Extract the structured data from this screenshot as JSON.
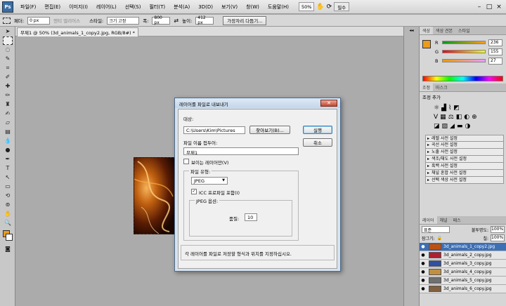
{
  "app": {
    "logo": "Ps",
    "menus": [
      "파일(F)",
      "편집(E)",
      "이미지(I)",
      "레이어(L)",
      "선택(S)",
      "필터(T)",
      "분석(A)",
      "3D(D)",
      "보기(V)",
      "창(W)",
      "도움말(H)"
    ],
    "zoom": "50%",
    "workspace": "필수",
    "colors": {
      "accent": "#3d6fb4",
      "foreground": "#ec9b1b"
    }
  },
  "options": {
    "feather_label": "페더:",
    "feather_value": "0 px",
    "antialias_label": "앤티 앨리어스",
    "style_label": "스타일:",
    "style_value": "크기 고정",
    "width_label": "폭:",
    "width_value": "800 px",
    "height_label": "높이:",
    "height_value": "412 px",
    "refine_button": "가장자리 다듬기..."
  },
  "document": {
    "tab_title": "무제1 @ 50% (3d_animals_1_copy2.jpg, RGB/8#) *"
  },
  "color_panel": {
    "tabs": [
      "색상",
      "색상 견본",
      "스타일"
    ],
    "channels": [
      {
        "label": "R",
        "value": "236"
      },
      {
        "label": "G",
        "value": "155"
      },
      {
        "label": "B",
        "value": "27"
      }
    ]
  },
  "adjust_panel": {
    "tabs": [
      "조정",
      "마스크"
    ],
    "title": "조정 추가",
    "presets": [
      "레벨 사전 설정",
      "곡선 사전 설정",
      "노출 사전 설정",
      "색조/채도 사전 설정",
      "흑백 사전 설정",
      "채널 혼합 사전 설정",
      "선택 색상 사전 설정"
    ]
  },
  "layers_panel": {
    "tabs": [
      "레이어",
      "채널",
      "패스"
    ],
    "blend_mode": "표준",
    "opacity_label": "불투명도:",
    "opacity_value": "100%",
    "lock_label": "잠그기:",
    "fill_label": "칠:",
    "fill_value": "100%",
    "layers": [
      {
        "name": "3d_animals_1_copy2.jpg",
        "selected": true,
        "color": "#c05010"
      },
      {
        "name": "3d_animals_2_copy.jpg",
        "selected": false,
        "color": "#b02030"
      },
      {
        "name": "3d_animals_3_copy.jpg",
        "selected": false,
        "color": "#3050a0"
      },
      {
        "name": "3d_animals_4_copy.jpg",
        "selected": false,
        "color": "#c09040"
      },
      {
        "name": "3d_animals_5_copy.jpg",
        "selected": false,
        "color": "#707070"
      },
      {
        "name": "3d_animals_6_copy.jpg",
        "selected": false,
        "color": "#806040"
      }
    ]
  },
  "dialog": {
    "title": "레이어를 파일로 내보내기",
    "target_label": "대상:",
    "target_path": "C:\\Users\\Kim\\Pictures",
    "browse_button": "찾아보기(B)...",
    "run_button": "실행",
    "cancel_button": "취소",
    "prefix_label": "파일 이름 접두어:",
    "prefix_value": "무제1",
    "visible_only_label": "보이는 레이어만(V)",
    "filetype_group_label": "파일 유형:",
    "filetype_value": "JPEG",
    "icc_label": "ICC 프로파일 포함(I)",
    "jpeg_options_label": "JPEG 옵션:",
    "quality_label": "품질:",
    "quality_value": "10",
    "hint": "각 레이어를 파일로 저장할 형식과 위치를 지정하십시오."
  }
}
